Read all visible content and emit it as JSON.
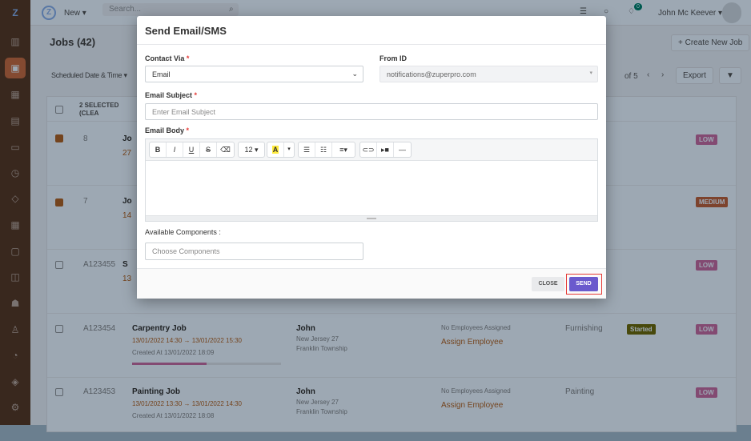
{
  "header": {
    "new_label": "New ▾",
    "search_placeholder": "Search...",
    "notification_count": "0",
    "user_name": "John Mc Keever ▾"
  },
  "page": {
    "title": "Jobs (42)",
    "create_button": "+ Create New Job",
    "filter_label": "Scheduled Date & Time ▾",
    "pagination": "of 5",
    "export_label": "Export"
  },
  "table": {
    "selected_text": "2 SELECTED (CLEA",
    "rows": [
      {
        "id": "8",
        "title": "Jo",
        "date": "27",
        "checked": true,
        "priority": "LOW"
      },
      {
        "id": "7",
        "title": "Jo",
        "date": "14",
        "checked": true,
        "priority": "MEDIUM"
      },
      {
        "id": "A123455",
        "title": "S",
        "date": "13",
        "checked": false,
        "priority": "LOW"
      },
      {
        "id": "A123454",
        "title": "Carpentry Job",
        "date": "13/01/2022 14:30 → 13/01/2022 15:30",
        "created": "Created At 13/01/2022 18:09",
        "customer": "John",
        "addr1": "New Jersey 27",
        "addr2": "Franklin Township",
        "employees": "No Employees Assigned",
        "assign": "Assign Employee",
        "category": "Furnishing",
        "status": "Started",
        "priority": "LOW",
        "checked": false
      },
      {
        "id": "A123453",
        "title": "Painting Job",
        "date": "13/01/2022 13:30 → 13/01/2022 14:30",
        "created": "Created At 13/01/2022 18:08",
        "customer": "John",
        "addr1": "New Jersey 27",
        "addr2": "Franklin Township",
        "employees": "No Employees Assigned",
        "assign": "Assign Employee",
        "category": "Painting",
        "priority": "LOW",
        "checked": false
      }
    ]
  },
  "modal": {
    "title": "Send Email/SMS",
    "contact_via_label": "Contact Via",
    "contact_via_value": "Email",
    "from_id_label": "From ID",
    "from_id_value": "notifications@zuperpro.com",
    "subject_label": "Email Subject",
    "subject_placeholder": "Enter Email Subject",
    "body_label": "Email Body",
    "font_size": "12 ▾",
    "components_label": "Available Components :",
    "components_placeholder": "Choose Components",
    "close_label": "CLOSE",
    "send_label": "SEND",
    "required_mark": "*"
  },
  "colors": {
    "accent": "#6a5acd",
    "low": "#3aa57a",
    "medium": "#2f86c6",
    "highlight": "#e53935"
  }
}
